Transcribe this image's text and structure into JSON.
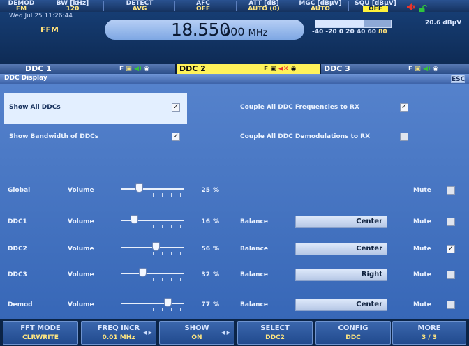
{
  "status": {
    "demod": {
      "label": "DEMOD",
      "value": "FM"
    },
    "bw": {
      "label": "BW [kHz]",
      "value": "120"
    },
    "detect": {
      "label": "DETECT",
      "value": "AVG"
    },
    "afc": {
      "label": "AFC",
      "value": "OFF"
    },
    "att": {
      "label": "ATT [dB]",
      "value": "AUTO (0)"
    },
    "mgc": {
      "label": "MGC [dBµV]",
      "value": "AUTO"
    },
    "squ": {
      "label": "SQU [dBµV]",
      "value": "OFF"
    }
  },
  "freq": {
    "datetime": "Wed Jul 25  11:26:44",
    "mode": "FFM",
    "main": "18.550",
    "rest": "000",
    "unit": "MHz",
    "level": "20.6 dBµV",
    "meter_ticks": "-40 -20  0  20 40 60",
    "meter_end": "80",
    "meter_fill_percent": 65
  },
  "ddc_tabs": [
    {
      "name": "DDC 1",
      "icons": "F  ◙  ◉  ◉",
      "selected": false
    },
    {
      "name": "DDC 2",
      "icons": "F  ◙  ✕  ◉",
      "selected": true
    },
    {
      "name": "DDC 3",
      "icons": "F  ◙  ◉  ◉",
      "selected": false
    }
  ],
  "dialog": {
    "title": "DDC Display",
    "esc": "ESC",
    "show_all": {
      "label": "Show All DDCs",
      "checked": true
    },
    "show_bw": {
      "label": "Show Bandwidth of DDCs",
      "checked": true
    },
    "couple_freq": {
      "label": "Couple All DDC Frequencies to RX",
      "checked": true
    },
    "couple_demod": {
      "label": "Couple All DDC Demodulations to RX",
      "checked": false
    },
    "volume_label": "Volume",
    "balance_label": "Balance",
    "mute_label": "Mute",
    "unit": "%",
    "rows": [
      {
        "name": "Global",
        "volume": 25,
        "balance": null,
        "mute": false
      },
      {
        "name": "DDC1",
        "volume": 16,
        "balance": "Center",
        "mute": false
      },
      {
        "name": "DDC2",
        "volume": 56,
        "balance": "Center",
        "mute": true
      },
      {
        "name": "DDC3",
        "volume": 32,
        "balance": "Right",
        "mute": false
      },
      {
        "name": "Demod",
        "volume": 77,
        "balance": "Center",
        "mute": false
      }
    ]
  },
  "softkeys": [
    {
      "title": "FFT MODE",
      "value": "CLRWRITE",
      "arrows": false
    },
    {
      "title": "FREQ INCR",
      "value": "0.01 MHz",
      "arrows": true
    },
    {
      "title": "SHOW",
      "value": "ON",
      "arrows": true
    },
    {
      "title": "SELECT",
      "value": "DDC2",
      "arrows": false
    },
    {
      "title": "CONFIG",
      "value": "DDC",
      "arrows": false
    },
    {
      "title": "MORE",
      "value": "3 / 3",
      "arrows": false
    }
  ],
  "colors": {
    "accent_yellow": "#fff25a",
    "speaker_off": "#e8352b",
    "speaker_on": "#38c43a",
    "lock": "#2ec43c"
  },
  "icons": {
    "speaker": "speaker-muted-icon",
    "lock": "padlock-open-icon"
  }
}
